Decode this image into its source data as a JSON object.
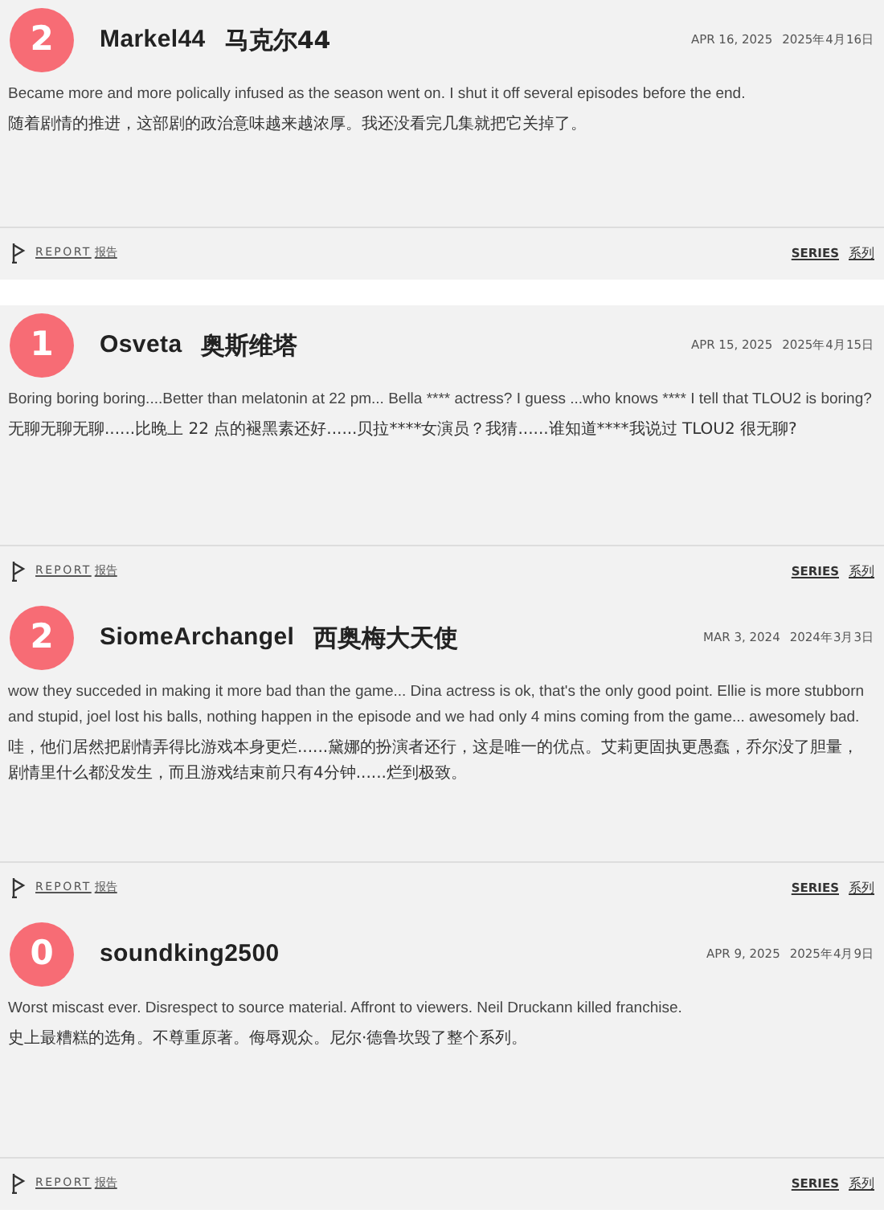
{
  "reviews": [
    {
      "score": "2",
      "username": "Markel44",
      "username_zh": "马克尔44",
      "date": "APR 16, 2025",
      "date_zh": "2025年4月16日",
      "text": "Became more and more polically infused as the season went on. I shut it off several episodes before the end.",
      "text_zh": "随着剧情的推进，这部剧的政治意味越来越浓厚。我还没看完几集就把它关掉了。",
      "report": "REPORT",
      "report_zh": "报告",
      "series": "SERIES",
      "series_zh": "系列"
    },
    {
      "score": "1",
      "username": "Osveta",
      "username_zh": "奥斯维塔",
      "date": "APR 15, 2025",
      "date_zh": "2025年4月15日",
      "text": "Boring boring boring....Better than melatonin at 22 pm... Bella **** actress? I guess ...who knows **** I tell that TLOU2 is boring?",
      "text_zh": "无聊无聊无聊......比晚上 22 点的褪黑素还好......贝拉****女演员？我猜......谁知道****我说过 TLOU2 很无聊?",
      "report": "REPORT",
      "report_zh": "报告",
      "series": "SERIES",
      "series_zh": "系列"
    },
    {
      "score": "2",
      "username": "SiomeArchangel",
      "username_zh": "西奥梅大天使",
      "date": "MAR 3, 2024",
      "date_zh": "2024年3月3日",
      "text": "wow they succeded in making it more bad than the game... Dina actress is ok, that's the only good point. Ellie is more stubborn and stupid, joel lost his balls, nothing happen in the episode and we had only 4 mins coming from the game... awesomely bad.",
      "text_zh": "哇，他们居然把剧情弄得比游戏本身更烂......黛娜的扮演者还行，这是唯一的优点。艾莉更固执更愚蠢，乔尔没了胆量，剧情里什么都没发生，而且游戏结束前只有4分钟......烂到极致。",
      "report": "REPORT",
      "report_zh": "报告",
      "series": "SERIES",
      "series_zh": "系列"
    },
    {
      "score": "0",
      "username": "soundking2500",
      "date": "APR 9, 2025",
      "date_zh": "2025年4月9日",
      "text": "Worst miscast ever. Disrespect to source material. Affront to viewers. Neil Druckann killed franchise.",
      "text_zh": "史上最糟糕的选角。不尊重原著。侮辱观众。尼尔·德鲁坎毁了整个系列。",
      "report": "REPORT",
      "report_zh": "报告",
      "series": "SERIES",
      "series_zh": "系列"
    }
  ]
}
